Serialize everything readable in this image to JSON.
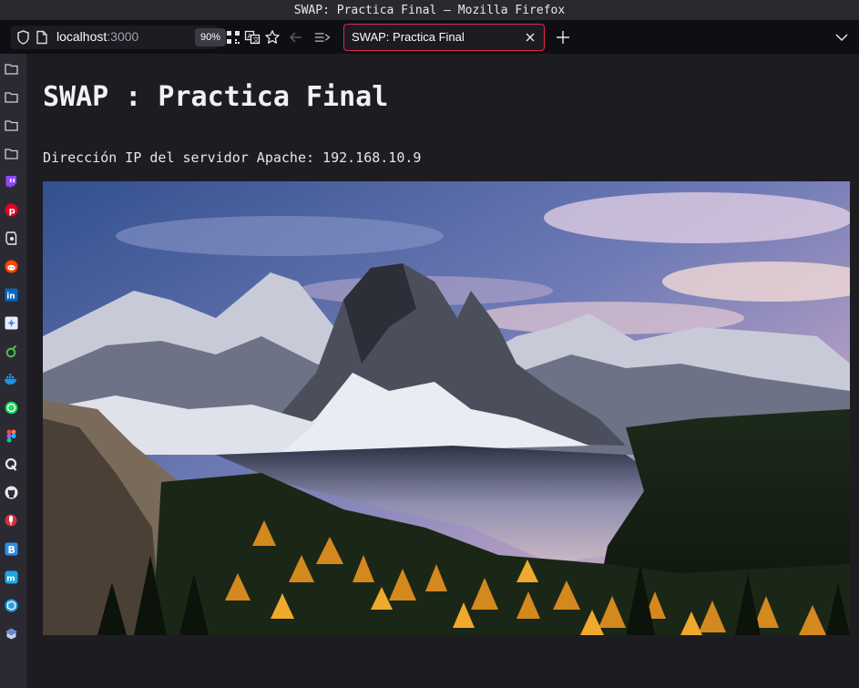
{
  "window": {
    "title": "SWAP: Practica Final — Mozilla Firefox"
  },
  "toolbar": {
    "url_host": "localhost",
    "url_port": ":3000",
    "zoom": "90%",
    "tab_title": "SWAP: Practica Final",
    "tab_close_glyph": "✕",
    "new_tab_glyph": "+",
    "tab_list_glyph": "⌄"
  },
  "sidebar": {
    "items": [
      {
        "icon": "folder-icon",
        "color": "#d0d0d4"
      },
      {
        "icon": "folder-icon",
        "color": "#d0d0d4"
      },
      {
        "icon": "folder-icon",
        "color": "#d0d0d4"
      },
      {
        "icon": "folder-icon",
        "color": "#d0d0d4"
      },
      {
        "icon": "twitch-icon",
        "color": "#9146ff"
      },
      {
        "icon": "pinterest-icon",
        "color": "#e60023"
      },
      {
        "icon": "greasemonkey-icon",
        "color": "#e8e8e8"
      },
      {
        "icon": "reddit-icon",
        "color": "#ff4500"
      },
      {
        "icon": "linkedin-icon",
        "color": "#0a66c2"
      },
      {
        "icon": "gemini-icon",
        "color": "#4a86f7"
      },
      {
        "icon": "ovo-icon",
        "color": "#4cc04c"
      },
      {
        "icon": "docker-icon",
        "color": "#1d91e6"
      },
      {
        "icon": "whatsapp-icon",
        "color": "#25d366"
      },
      {
        "icon": "figma-icon",
        "color": "#f24e1e"
      },
      {
        "icon": "quora-icon",
        "color": "#e8e8e8"
      },
      {
        "icon": "github-icon",
        "color": "#e8e8e8"
      },
      {
        "icon": "microphone-icon",
        "color": "#d0323a"
      },
      {
        "icon": "bootstrap-icon",
        "color": "#2f8fe6"
      },
      {
        "icon": "mastodon-icon",
        "color": "#1fa7e3"
      },
      {
        "icon": "package-icon",
        "color": "#2a9de0"
      },
      {
        "icon": "tutanota-icon",
        "color": "#6a8ad8"
      }
    ]
  },
  "page": {
    "heading": "SWAP : Practica Final",
    "ip_line": "Dirección IP del servidor Apache: 192.168.10.9",
    "image_description": "mountain-lake-landscape"
  }
}
